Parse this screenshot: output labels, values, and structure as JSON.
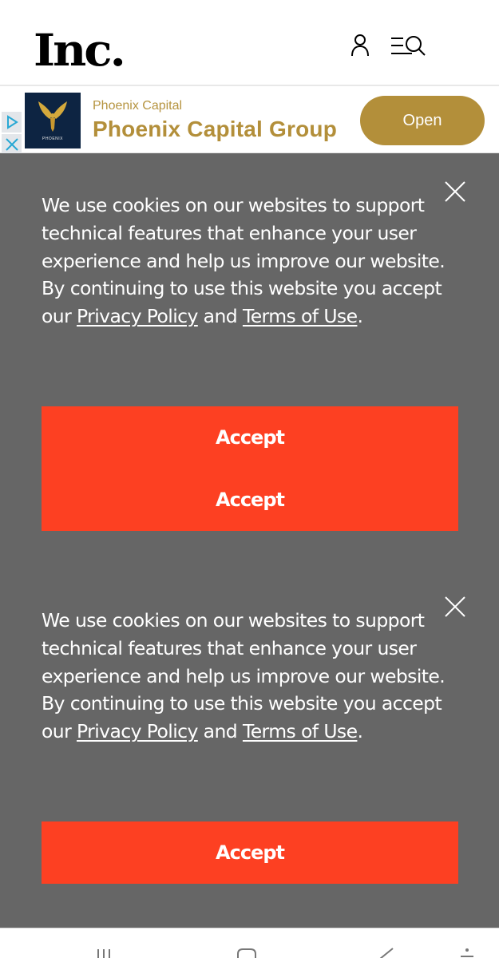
{
  "header": {
    "logo": "Inc.",
    "icons": [
      "user-icon",
      "menu-search-icon"
    ]
  },
  "ad": {
    "brand_logo_text": "PHOENIX",
    "subtitle": "Phoenix Capital",
    "title": "Phoenix Capital Group",
    "open_label": "Open",
    "colors": {
      "gold": "#b38f3a",
      "logo_bg": "#0d2442"
    }
  },
  "cookie_banners": [
    {
      "text_before": "We use cookies on our websites to support technical features that enhance your user experience and help us improve our website. By continuing to use this website you accept our ",
      "privacy_link": "Privacy Policy",
      "text_middle": " and ",
      "terms_link": "Terms of Use",
      "text_after": ".",
      "buttons": [
        "Accept",
        "Accept"
      ]
    },
    {
      "text_before": "We use cookies on our websites to support technical features that enhance your user experience and help us improve our website. By continuing to use this website you accept our ",
      "privacy_link": "Privacy Policy",
      "text_middle": " and ",
      "terms_link": "Terms of Use",
      "text_after": ".",
      "buttons": [
        "Accept"
      ]
    }
  ],
  "colors": {
    "overlay": "#666666",
    "accept": "#fd4022"
  },
  "navbar": {
    "icons": [
      "recent-apps-icon",
      "home-icon",
      "back-icon",
      "accessibility-icon"
    ]
  }
}
